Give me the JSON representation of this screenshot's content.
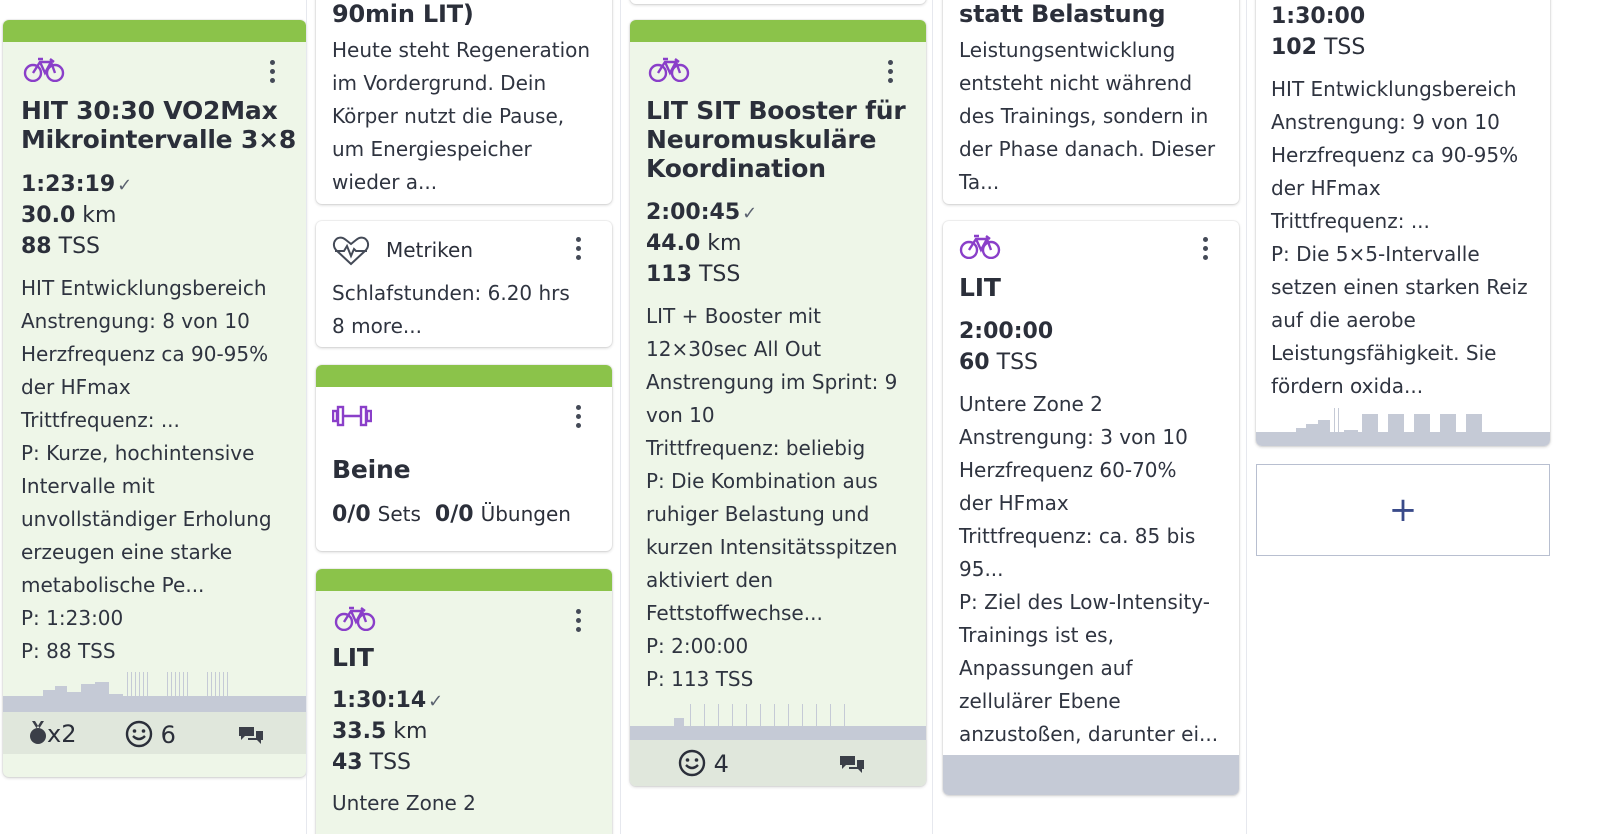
{
  "colors": {
    "done_bar": "#8bc34a",
    "done_bg": "#eef6e8",
    "accent_purple": "#8a3fc9"
  },
  "col1": {
    "card": {
      "title_l1": "HIT 30:30 VO2Max",
      "title_l2": "Mikrointervalle 3×8",
      "duration": "1:23:19",
      "distance_val": "30.0",
      "distance_unit": "km",
      "tss_val": "88",
      "tss_unit": "TSS",
      "desc": [
        "HIT Entwicklungsbereich",
        "Anstrengung: 8 von 10",
        "Herzfrequenz ca 90-95%",
        "der HFmax",
        "Trittfrequenz: ...",
        "P: Kurze, hochintensive",
        "Intervalle mit",
        "unvollständiger Erholung",
        "erzeugen eine starke",
        "metabolische Pe...",
        "P: 1:23:00",
        "P: 88 TSS"
      ],
      "medal_count": "x2",
      "feel_count": "6"
    }
  },
  "col2": {
    "note": {
      "title_tail": "90min LIT)",
      "desc": [
        "Heute steht Regeneration",
        "im Vordergrund. Dein",
        "Körper nutzt die Pause,",
        "um Energiespeicher",
        "wieder a..."
      ]
    },
    "metrics": {
      "title": "Metriken",
      "line1": "Schlafstunden: 6.20 hrs",
      "line2": "8 more..."
    },
    "strength": {
      "title": "Beine",
      "sets_val": "0/0",
      "sets_label": "Sets",
      "ex_val": "0/0",
      "ex_label": "Übungen"
    },
    "lit": {
      "title": "LIT",
      "duration": "1:30:14",
      "distance_val": "33.5",
      "distance_unit": "km",
      "tss_val": "43",
      "tss_unit": "TSS",
      "desc_cut": "Untere Zone 2"
    }
  },
  "col3": {
    "card": {
      "title_l1": "LIT SIT Booster für",
      "title_l2": "Neuromuskuläre",
      "title_l3": "Koordination",
      "duration": "2:00:45",
      "distance_val": "44.0",
      "distance_unit": "km",
      "tss_val": "113",
      "tss_unit": "TSS",
      "desc": [
        "LIT + Booster mit",
        "12×30sec All Out",
        "Anstrengung im Sprint: 9",
        "von 10",
        "Trittfrequenz: beliebig",
        "P: Die Kombination aus",
        "ruhiger Belastung und",
        "kurzen Intensitätsspitzen",
        "aktiviert den",
        "Fettstoffwechse...",
        "P: 2:00:00",
        "P: 113 TSS"
      ],
      "feel_count": "4"
    }
  },
  "col4": {
    "note": {
      "title_tail": "statt Belastung",
      "desc": [
        "Leistungsentwicklung",
        "entsteht nicht während",
        "des Trainings, sondern in",
        "der Phase danach. Dieser",
        "Ta..."
      ]
    },
    "lit": {
      "title": "LIT",
      "duration": "2:00:00",
      "tss_val": "60",
      "tss_unit": "TSS",
      "desc": [
        "Untere Zone 2",
        "Anstrengung: 3 von 10",
        "Herzfrequenz 60-70%",
        "der HFmax",
        "Trittfrequenz: ca. 85 bis",
        "95...",
        "P: Ziel des Low-Intensity-",
        "Trainings ist es,",
        "Anpassungen auf",
        "zellulärer Ebene",
        "anzustoßen, darunter ei..."
      ]
    }
  },
  "col5": {
    "card": {
      "duration": "1:30:00",
      "tss_val": "102",
      "tss_unit": "TSS",
      "desc": [
        "HIT Entwicklungsbereich",
        "Anstrengung: 9 von 10",
        "Herzfrequenz ca 90-95%",
        "der HFmax",
        "Trittfrequenz: ...",
        "P: Die 5×5-Intervalle",
        "setzen einen starken Reiz",
        "auf die aerobe",
        "Leistungsfähigkeit. Sie",
        "fördern oxida..."
      ]
    },
    "add_label": "+"
  }
}
